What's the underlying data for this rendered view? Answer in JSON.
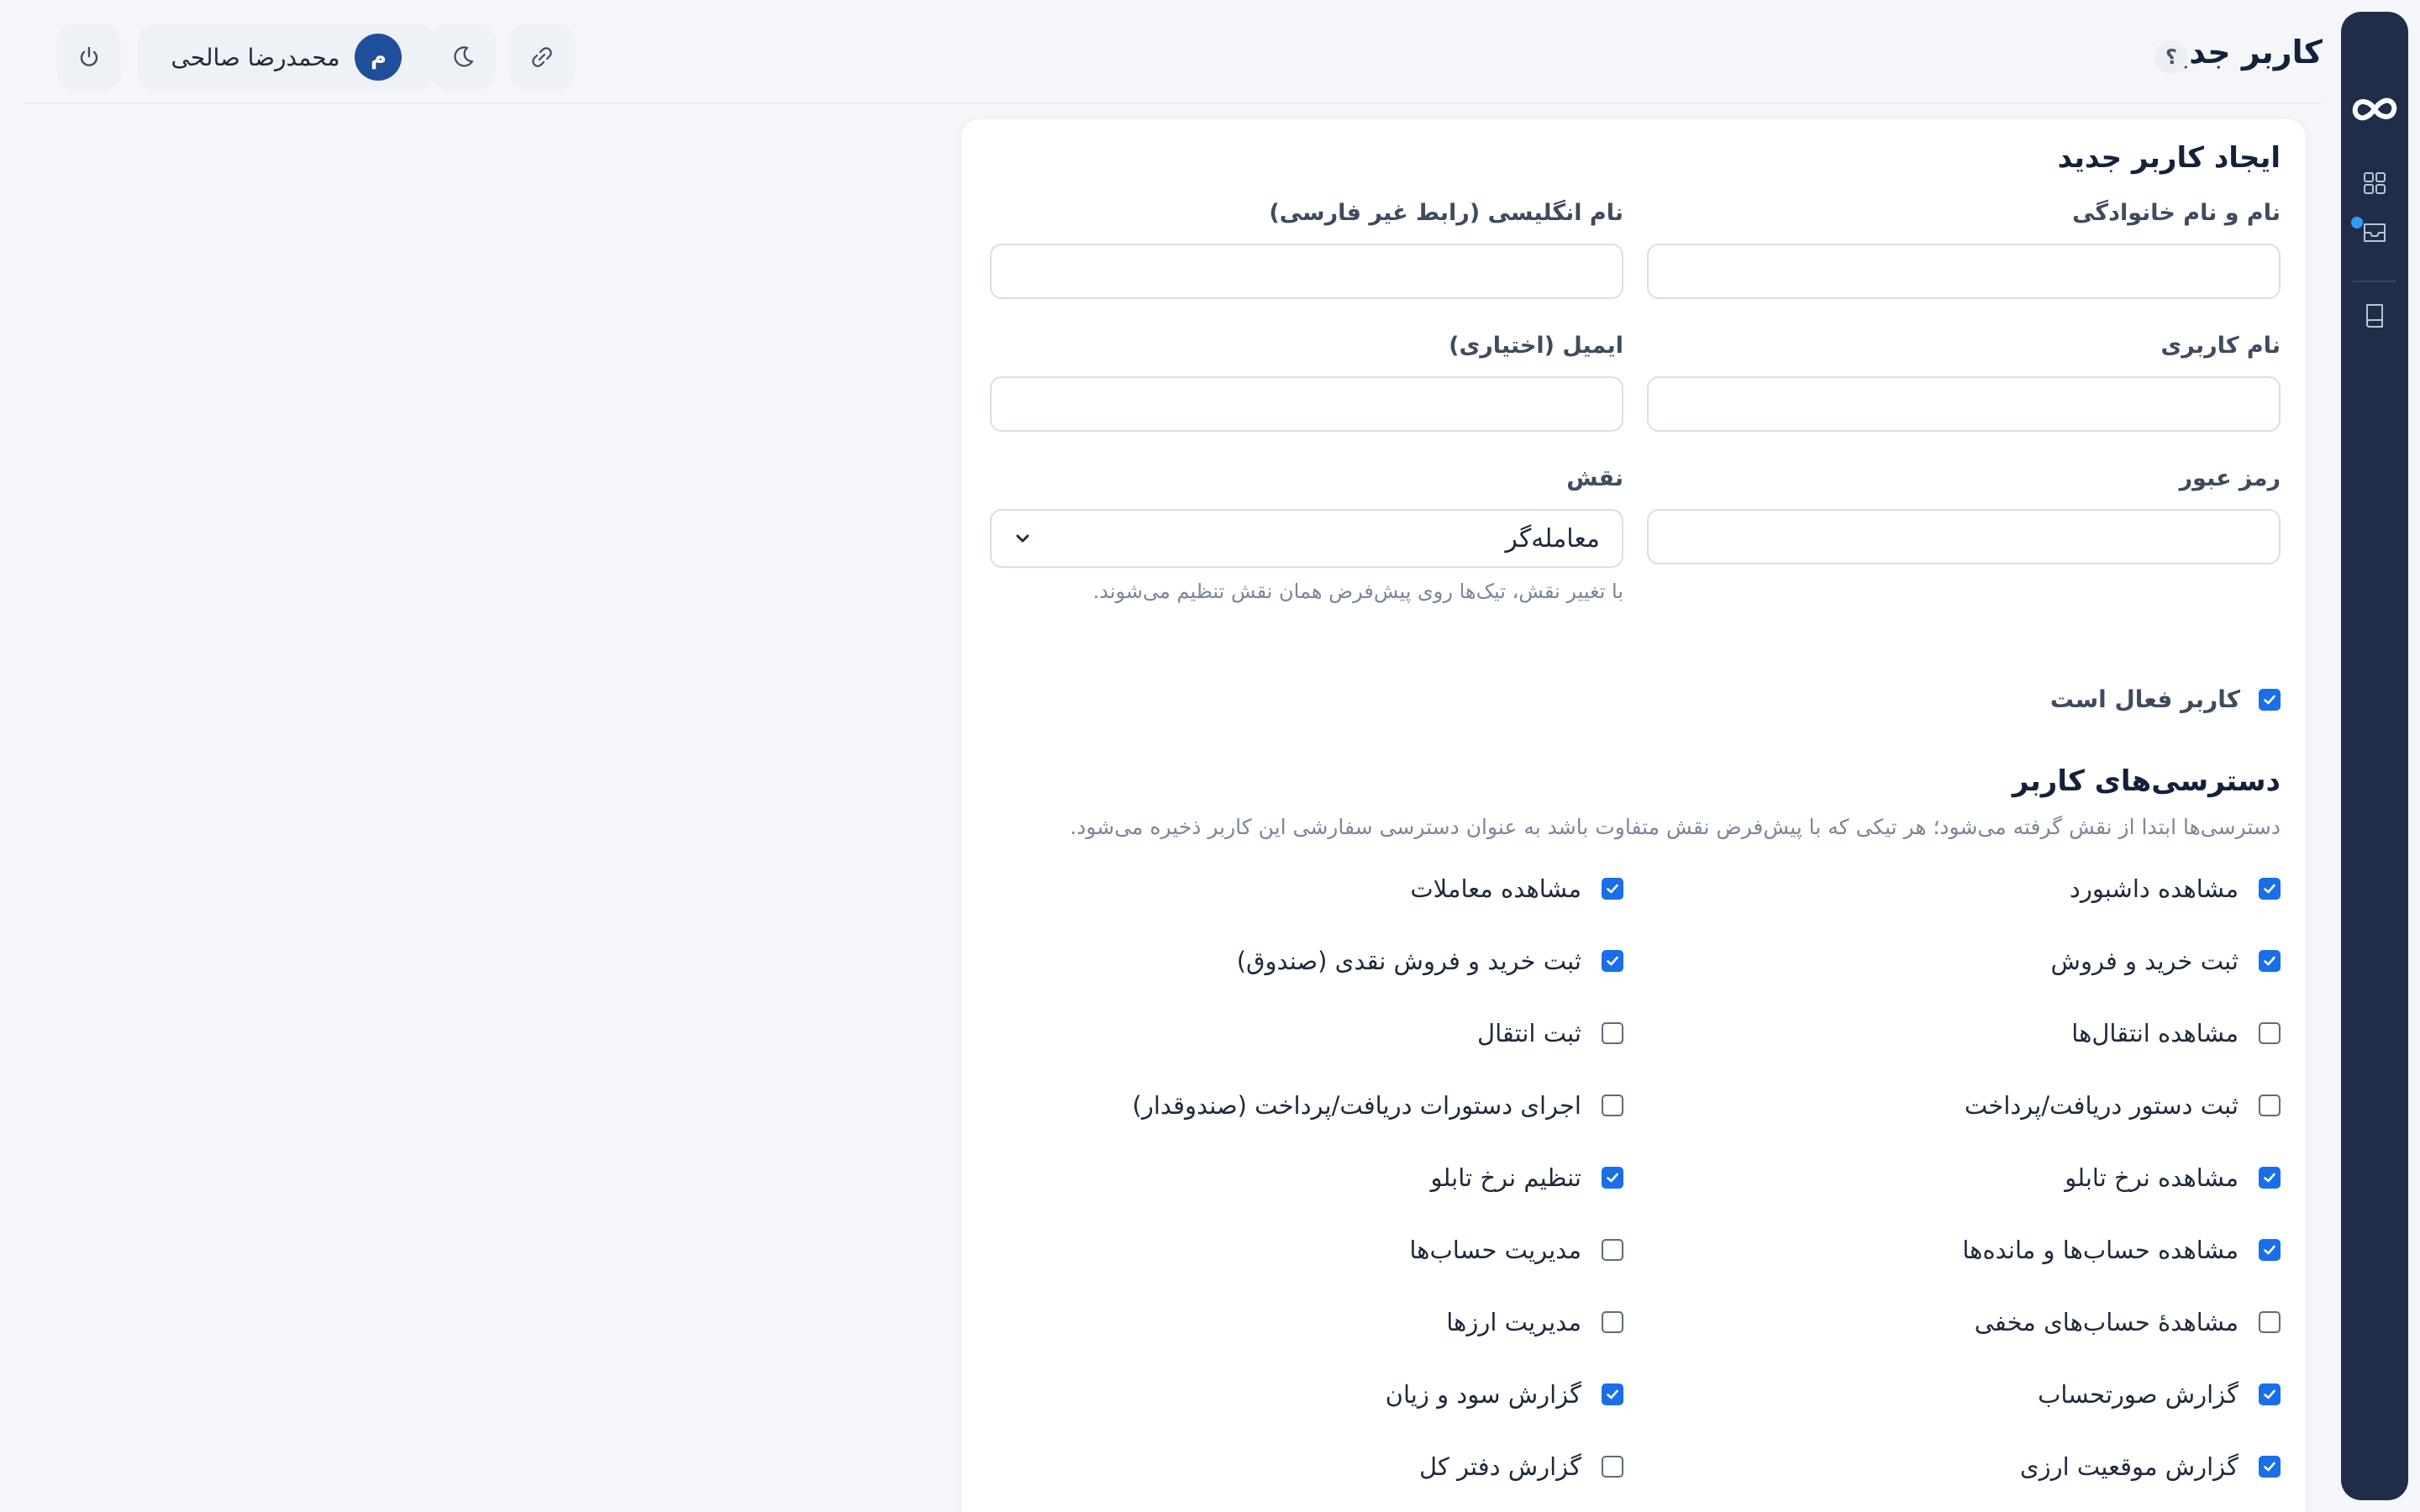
{
  "header": {
    "page_title": "کاربر جدید",
    "help_label": "؟",
    "user": {
      "name": "محمدرضا صالحی",
      "avatar_initial": "م"
    }
  },
  "rail": {
    "icons": [
      "infinity-logo-icon",
      "grid-icon",
      "inbox-icon",
      "book-icon"
    ],
    "accent": "#2f9bff",
    "background": "#1f2d48"
  },
  "form": {
    "title": "ایجاد کاربر جدید",
    "fields": {
      "full_name": {
        "label": "نام و نام خانوادگی",
        "value": ""
      },
      "english_name": {
        "label": "نام انگلیسی (رابط غیر فارسی)",
        "value": ""
      },
      "username": {
        "label": "نام کاربری",
        "value": ""
      },
      "email": {
        "label": "ایمیل (اختیاری)",
        "value": ""
      },
      "password": {
        "label": "رمز عبور",
        "value": ""
      },
      "role": {
        "label": "نقش",
        "value": "معامله‌گر",
        "hint": "با تغییر نقش، تیک‌ها روی پیش‌فرض همان نقش تنظیم می‌شوند."
      }
    },
    "active": {
      "label": "کاربر فعال است",
      "checked": true
    }
  },
  "permissions": {
    "title": "دسترسی‌های کاربر",
    "description": "دسترسی‌ها ابتدا از نقش گرفته می‌شود؛ هر تیکی که با پیش‌فرض نقش متفاوت باشد به عنوان دسترسی سفارشی این کاربر ذخیره می‌شود.",
    "items": [
      {
        "label": "مشاهده داشبورد",
        "checked": true
      },
      {
        "label": "مشاهده معاملات",
        "checked": true
      },
      {
        "label": "ثبت خرید و فروش",
        "checked": true
      },
      {
        "label": "ثبت خرید و فروش نقدی (صندوق)",
        "checked": true
      },
      {
        "label": "مشاهده انتقال‌ها",
        "checked": false
      },
      {
        "label": "ثبت انتقال",
        "checked": false
      },
      {
        "label": "ثبت دستور دریافت/پرداخت",
        "checked": false
      },
      {
        "label": "اجرای دستورات دریافت/پرداخت (صندوقدار)",
        "checked": false
      },
      {
        "label": "مشاهده نرخ تابلو",
        "checked": true
      },
      {
        "label": "تنظیم نرخ تابلو",
        "checked": true
      },
      {
        "label": "مشاهده حساب‌ها و مانده‌ها",
        "checked": true
      },
      {
        "label": "مدیریت حساب‌ها",
        "checked": false
      },
      {
        "label": "مشاهدهٔ حساب‌های مخفی",
        "checked": false
      },
      {
        "label": "مدیریت ارزها",
        "checked": false
      },
      {
        "label": "گزارش صورتحساب",
        "checked": true
      },
      {
        "label": "گزارش سود و زیان",
        "checked": true
      },
      {
        "label": "گزارش موقعیت ارزی",
        "checked": true
      },
      {
        "label": "گزارش دفتر کل",
        "checked": false
      }
    ]
  },
  "colors": {
    "primary": "#1a6ee8",
    "avatar": "#1f4e9a"
  }
}
